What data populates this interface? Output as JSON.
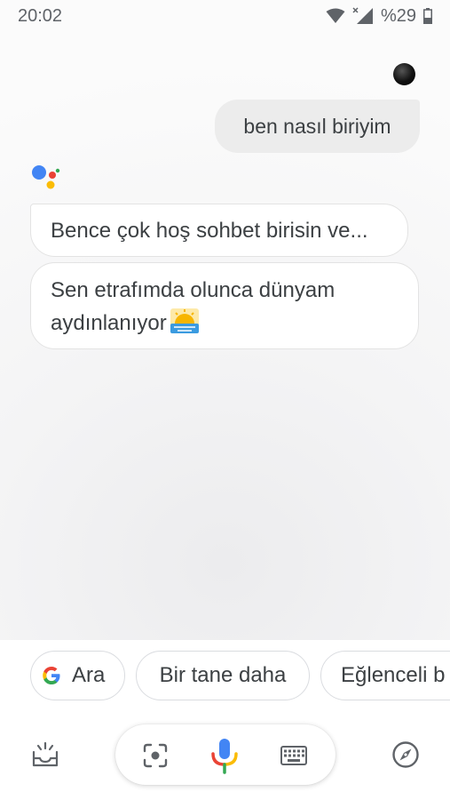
{
  "status_bar": {
    "time": "20:02",
    "battery": "%29",
    "icons": [
      "wifi-icon",
      "signal-icon",
      "battery-icon"
    ]
  },
  "conversation": {
    "user_message": "ben nasıl biriyim",
    "assistant_messages": [
      "Bence çok hoş sohbet birisin ve...",
      "Sen etrafımda olunca dünyam aydınlanıyor"
    ],
    "assistant_line_2a": "Sen etrafımda olunca dünyam",
    "assistant_line_2b": "aydınlanıyor"
  },
  "suggestions": {
    "chip_1": "Ara",
    "chip_2": "Bir tane daha",
    "chip_3": "Eğlenceli b"
  },
  "toolbar": {
    "icons": [
      "updates-inbox-icon",
      "lens-icon",
      "mic-icon",
      "keyboard-icon",
      "explore-compass-icon"
    ]
  },
  "colors": {
    "google_blue": "#4285F4",
    "google_red": "#EA4335",
    "google_yellow": "#FBBC05",
    "google_green": "#34A853",
    "icon_gray": "#5f6368"
  }
}
